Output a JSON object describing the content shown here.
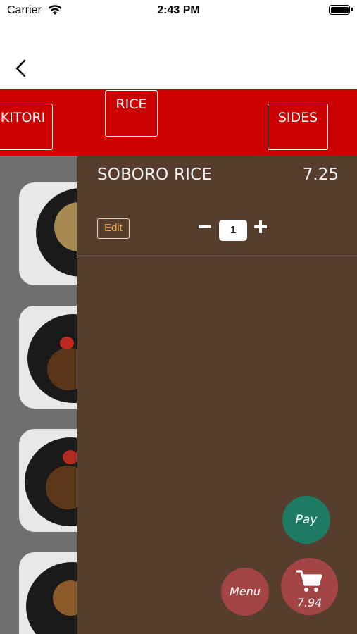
{
  "status_bar": {
    "carrier": "Carrier",
    "time": "2:43 PM"
  },
  "nav": {
    "back_icon": "chevron-left-icon"
  },
  "categories": {
    "tabs": [
      "KITORI",
      "RICE",
      "SIDES"
    ],
    "background_color": "#cc0000"
  },
  "cart": {
    "items": [
      {
        "name": "SOBORO RICE",
        "price": "7.25",
        "edit_label": "Edit",
        "quantity": "1"
      }
    ],
    "background_color": "#573d2d"
  },
  "actions": {
    "pay_label": "Pay",
    "menu_label": "Menu",
    "cart_total": "7.94",
    "cart_icon": "shopping-cart-icon",
    "pay_color": "#1e7a63",
    "menu_color": "#a34545"
  }
}
